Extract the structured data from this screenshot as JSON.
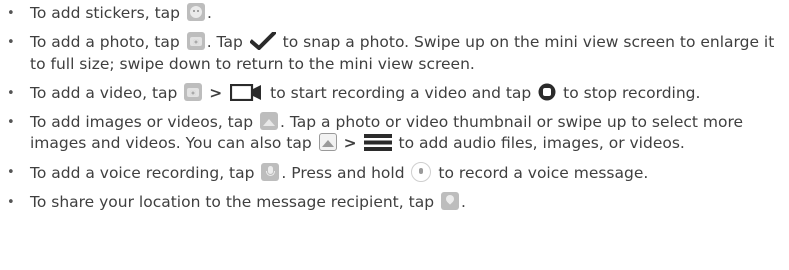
{
  "items": [
    {
      "t1": "To add stickers, tap",
      "t2": "."
    },
    {
      "t1": "To add a photo, tap",
      "t2": ". Tap",
      "t3": "to snap a photo. Swipe up on the mini view screen to enlarge it to full size; swipe down to return to the mini view screen."
    },
    {
      "t1": "To add a video, tap",
      "sep": ">",
      "t2": "to start recording a video and tap",
      "t3": "to stop recording."
    },
    {
      "t1": "To add images or videos, tap",
      "t2": ". Tap a photo or video thumbnail or swipe up to select more images and videos. You can also tap",
      "sep": ">",
      "t3": "to add audio files, images, or videos."
    },
    {
      "t1": "To add a voice recording, tap",
      "t2": ". Press and hold",
      "t3": "to record a voice message."
    },
    {
      "t1": "To share your location to the message recipient, tap",
      "t2": "."
    }
  ],
  "icons": {
    "sticker": "sticker-icon",
    "camera": "camera-icon",
    "shutter_check": "checkmark-icon",
    "video": "video-camera-icon",
    "stop": "stop-record-icon",
    "gallery": "gallery-icon",
    "menu": "menu-icon",
    "mic": "microphone-icon",
    "record": "record-voice-icon",
    "location": "location-pin-icon"
  }
}
